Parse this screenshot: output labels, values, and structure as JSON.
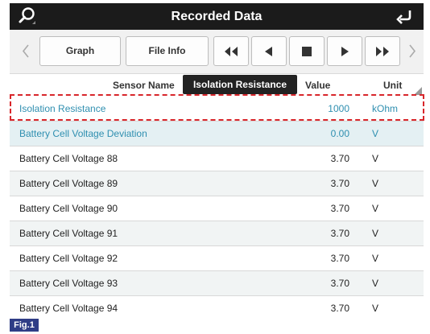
{
  "window": {
    "title": "Recorded Data"
  },
  "toolbar": {
    "graph_label": "Graph",
    "file_info_label": "File Info",
    "icons": [
      "search-icon",
      "back-arrow-icon",
      "chevron-left-icon",
      "rewind-icon",
      "step-back-icon",
      "stop-icon",
      "play-icon",
      "fast-forward-icon",
      "chevron-right-icon"
    ]
  },
  "table": {
    "headers": {
      "name": "Sensor Name",
      "value": "Value",
      "unit": "Unit"
    },
    "tooltip": "Isolation Resistance",
    "rows": [
      {
        "name": "Isolation Resistance",
        "value": "1000",
        "unit": "kOhm"
      },
      {
        "name": "Battery Cell Voltage Deviation",
        "value": "0.00",
        "unit": "V"
      },
      {
        "name": "Battery Cell Voltage 88",
        "value": "3.70",
        "unit": "V"
      },
      {
        "name": "Battery Cell Voltage 89",
        "value": "3.70",
        "unit": "V"
      },
      {
        "name": "Battery Cell Voltage 90",
        "value": "3.70",
        "unit": "V"
      },
      {
        "name": "Battery Cell Voltage 91",
        "value": "3.70",
        "unit": "V"
      },
      {
        "name": "Battery Cell Voltage 92",
        "value": "3.70",
        "unit": "V"
      },
      {
        "name": "Battery Cell Voltage 93",
        "value": "3.70",
        "unit": "V"
      },
      {
        "name": "Battery Cell Voltage 94",
        "value": "3.70",
        "unit": "V"
      }
    ]
  },
  "figure_label": "Fig.1",
  "colors": {
    "titlebar": "#1b1b1b",
    "highlight_text": "#2f8fb0",
    "callout_dashes": "#d8262b",
    "fig_label_bg": "#2f3d86"
  }
}
